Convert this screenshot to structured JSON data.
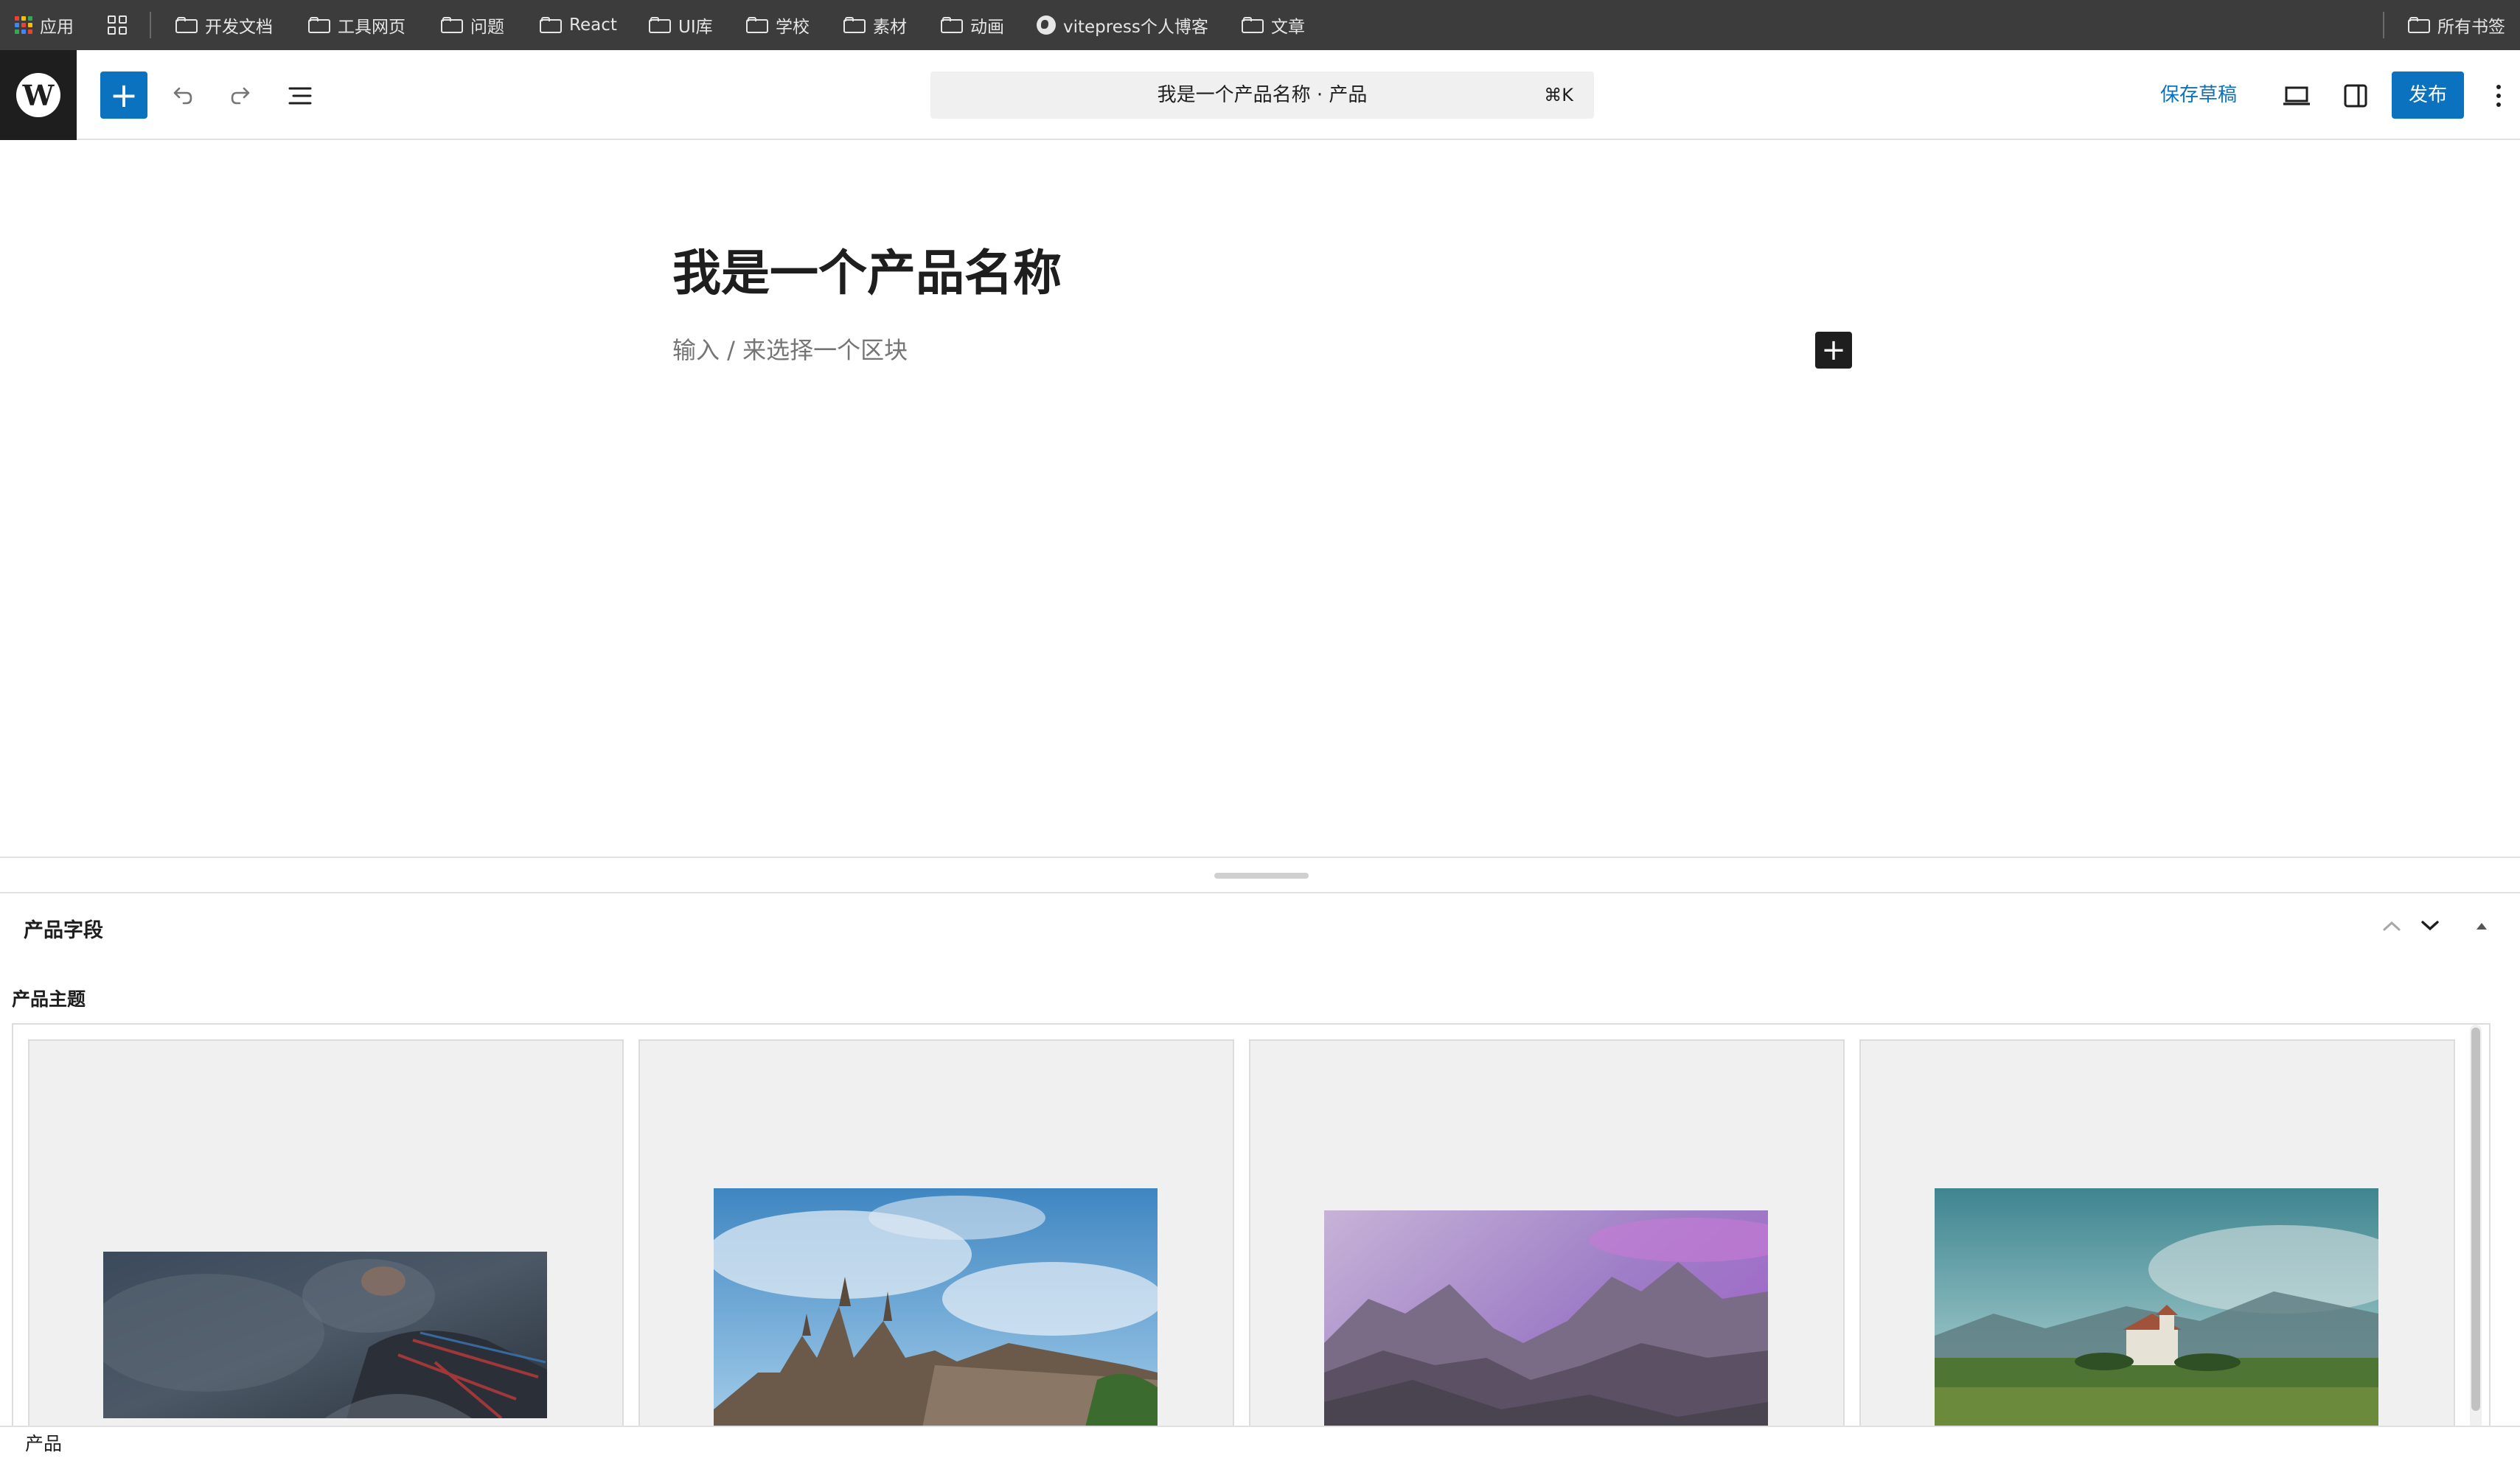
{
  "bookmarks": {
    "apps_label": "应用",
    "items": [
      "开发文档",
      "工具网页",
      "问题",
      "React",
      "UI库",
      "学校",
      "素材",
      "动画",
      "vitepress个人博客",
      "文章"
    ],
    "all_bookmarks": "所有书签"
  },
  "header": {
    "document_title": "我是一个产品名称 · 产品",
    "shortcut": "⌘K",
    "save_draft": "保存草稿",
    "publish": "发布"
  },
  "editor": {
    "post_title": "我是一个产品名称",
    "block_placeholder": "输入 / 来选择一个区块"
  },
  "metabox": {
    "title": "产品字段",
    "field_label": "产品主题",
    "images": [
      {
        "name": "dark-smoke-photo"
      },
      {
        "name": "castle-sky-photo"
      },
      {
        "name": "purple-mountains-photo"
      },
      {
        "name": "meadow-house-photo"
      }
    ]
  },
  "footer": {
    "breadcrumb": "产品"
  },
  "colors": {
    "accent": "#0a72be",
    "bookmarks_bg": "#3c3c3c",
    "logo_bg": "#1e1e1e"
  }
}
